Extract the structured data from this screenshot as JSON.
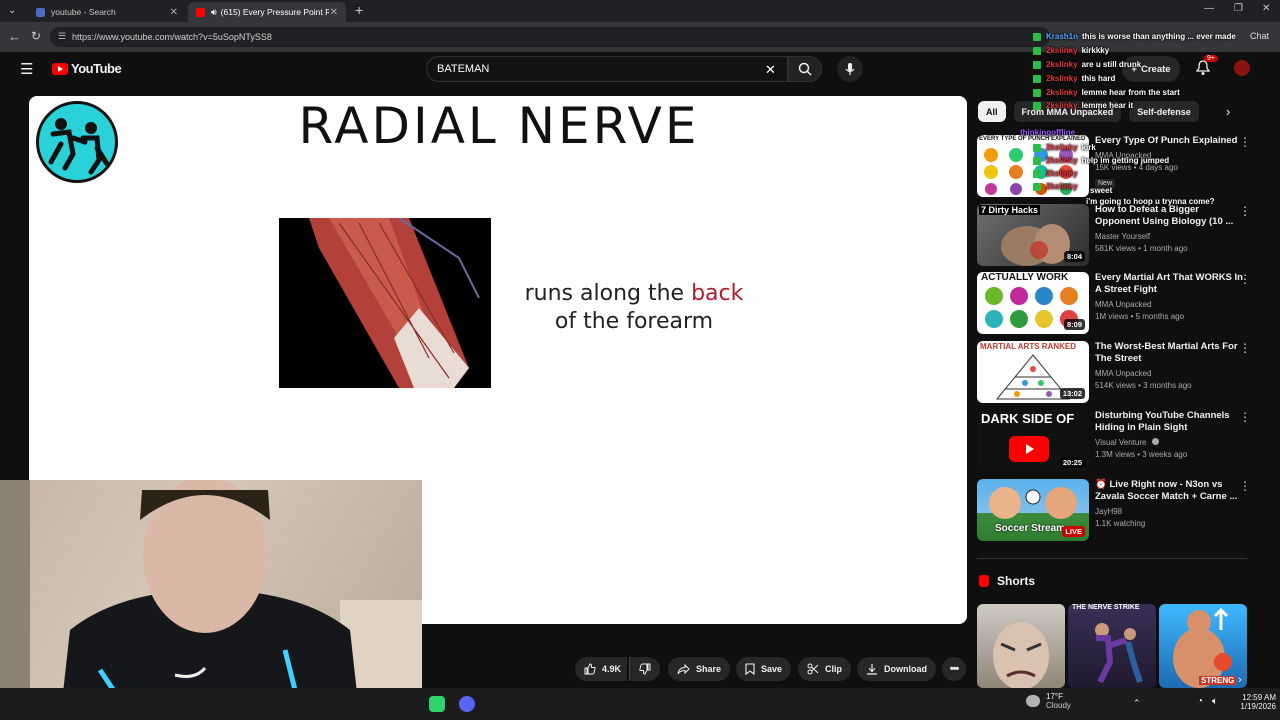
{
  "browser": {
    "tabs": [
      {
        "title": "youtube - Search",
        "active": false
      },
      {
        "title": "(615) Every Pressure Point Ra",
        "active": true
      }
    ],
    "url": "https://www.youtube.com/watch?v=5uSopNTySS8"
  },
  "youtube": {
    "logo_text": "YouTube",
    "search_value": "BATEMAN",
    "create_label": "Create",
    "notif_count": "9+"
  },
  "slide": {
    "title": "RADIAL NERVE",
    "text_line1_a": "runs along the ",
    "text_line1_b": "back",
    "text_line2": "of the forearm"
  },
  "actions": {
    "likes": "4.9K",
    "share": "Share",
    "save": "Save",
    "clip": "Clip",
    "download": "Download"
  },
  "chips": [
    "All",
    "From MMA Unpacked",
    "Self-defense"
  ],
  "recs": [
    {
      "title": "Every Type Of Punch Explained",
      "channel": "MMA Unpacked",
      "views": "15K views • 4 days ago",
      "badge": "New",
      "thumb_text": "EVERY TYPE OF PUNCH EXPLAINED",
      "duration": ""
    },
    {
      "title": "How to Defeat a Bigger Opponent Using Biology (10 ...",
      "channel": "Master Yourself",
      "views": "581K views • 1 month ago",
      "thumb_text": "7 Dirty Hacks",
      "duration": "8:04"
    },
    {
      "title": "Every Martial Art That WORKS In A Street Fight",
      "channel": "MMA Unpacked",
      "views": "1M views • 5 months ago",
      "thumb_text": "ACTUALLY WORK",
      "duration": "8:09"
    },
    {
      "title": "The Worst-Best Martial Arts For The Street",
      "channel": "MMA Unpacked",
      "views": "514K views • 3 months ago",
      "thumb_text": "MARTIAL ARTS RANKED",
      "duration": "13:02"
    },
    {
      "title": "Disturbing YouTube Channels Hiding in Plain Sight",
      "channel": "Visual Venture",
      "views": "1.3M views • 3 weeks ago",
      "thumb_text": "DARK SIDE OF",
      "duration": "20:25"
    },
    {
      "title": "Live Right now - N3on vs Zavala Soccer Match + Carne ...",
      "channel": "JayH98",
      "views": "1.1K watching",
      "thumb_text": "Soccer Stream",
      "duration": "LIVE"
    }
  ],
  "shorts": {
    "heading": "Shorts",
    "items": [
      "",
      "THE NERVE STRIKE",
      "STRENG"
    ]
  },
  "chat": [
    {
      "user": "Krash1n",
      "msg": "this is worse than anything ... ever made",
      "color": "#4da3ff"
    },
    {
      "user": "2kslinky",
      "msg": "kirkkky",
      "color": "#e0353f"
    },
    {
      "user": "2kslinky",
      "msg": "are u still drunk",
      "color": "#e0353f"
    },
    {
      "user": "2kslinky",
      "msg": "this hard",
      "color": "#e0353f"
    },
    {
      "user": "2kslinky",
      "msg": "lemme hear from the start",
      "color": "#e0353f"
    },
    {
      "user": "2kslinky",
      "msg": "lemme hear it",
      "color": "#e0353f"
    },
    {
      "user": "thinkingoffline",
      "msg": "",
      "color": "#9b59ff"
    },
    {
      "user": "2kslinky",
      "msg": "kirk",
      "color": "#e0353f"
    },
    {
      "user": "2kslinky",
      "msg": "help im getting jumped",
      "color": "#e0353f"
    },
    {
      "user": "2kslinky",
      "msg": "",
      "color": "#e0353f"
    },
    {
      "user": "2kslinky",
      "msg": "",
      "color": "#e0353f"
    },
    {
      "user": "2kslinky",
      "msg": "sweet",
      "color": "#e0353f"
    },
    {
      "user": "",
      "msg": "i'm going to hoop u trynna come?",
      "color": "#e0353f"
    }
  ],
  "taskbar": {
    "weather_temp": "17°F",
    "weather_desc": "Cloudy",
    "time": "12:59 AM",
    "date": "1/19/2026"
  },
  "colors": {
    "brand_red": "#ff0000",
    "slide_accent": "#b31b2a"
  }
}
